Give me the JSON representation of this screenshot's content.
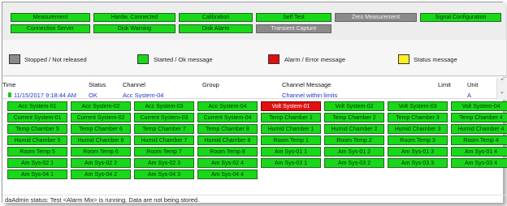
{
  "toolbar": {
    "row1": [
      {
        "label": "Measurement",
        "state": "green"
      },
      {
        "label": "Hardw. Connected",
        "state": "green"
      },
      {
        "label": "Calibration",
        "state": "green"
      },
      {
        "label": "Self Test",
        "state": "green"
      },
      {
        "label": "Zero Measurement",
        "state": "gray"
      },
      {
        "label": "Signal Configuration",
        "state": "green"
      }
    ],
    "row2": [
      {
        "label": "Connection Server",
        "state": "green"
      },
      {
        "label": "Disk Warning",
        "state": "green"
      },
      {
        "label": "Disk Alarm",
        "state": "green"
      },
      {
        "label": "Transient Capture",
        "state": "gray"
      }
    ]
  },
  "legend": [
    {
      "label": "Stopped / Not released",
      "color": "#8a8a8a"
    },
    {
      "label": "Started / Ok message",
      "color": "#19d819"
    },
    {
      "label": "Alarm / Error message",
      "color": "#e01010"
    },
    {
      "label": "Status message",
      "color": "#ffee22"
    }
  ],
  "table": {
    "headers": [
      "Time",
      "Status",
      "Channel",
      "Group",
      "Channel Message",
      "Limit",
      "Unit"
    ],
    "row": {
      "time": "11/15/2017 9:18:44 AM",
      "status": "OK",
      "channel": "Acc System-04",
      "group": "",
      "message": "Channel within limits",
      "limit": "",
      "unit": "A"
    }
  },
  "channels": [
    [
      "Acc System-01",
      "Acc System-02",
      "Acc System-03",
      "Acc System-04",
      "Volt System-01",
      "Volt System-02",
      "Volt System-03",
      "Volt System-04"
    ],
    [
      "Current System-01",
      "Current System-02",
      "Current System-03",
      "Current System-04",
      "Temp Chamber 1",
      "Temp Chamber 2",
      "Temp Chamber 3",
      "Temp Chamber 4"
    ],
    [
      "Temp Chamber 5",
      "Temp Chamber 6",
      "Temp Chamber 7",
      "Temp Chamber 8",
      "Humid Chamber 1",
      "Humid Chamber 2",
      "Humid Chamber 3",
      "Humid Chamber 4"
    ],
    [
      "Humid Chamber 5",
      "Humid Chamber 6",
      "Humid Chamber 7",
      "Humid Chamber 8",
      "Room Temp 1",
      "Room Temp 2",
      "Room Temp 3",
      "Room Temp 4"
    ],
    [
      "Room Temp 5",
      "Room Temp 6",
      "Room Temp 7",
      "Room Temp 8",
      "Am Sys-01 1",
      "Am Sys-01 2",
      "Am Sys-01 3",
      "Am Sys-01 4"
    ],
    [
      "Am Sys-02 1",
      "Am Sys-02 2",
      "Am Sys-02 3",
      "Am Sys-02 4",
      "Am Sys-03 1",
      "Am Sys-03 2",
      "Am Sys-03 3",
      "Am Sys-03 4"
    ],
    [
      "Am Sys-04 1",
      "Am Sys-04 2",
      "Am Sys-04 3",
      "Am Sys-04 4"
    ]
  ],
  "alarm_channel": "Volt System-01",
  "status_bar": "daAdmin status: Test <Alarm Mix> is running. Data are not being stored."
}
